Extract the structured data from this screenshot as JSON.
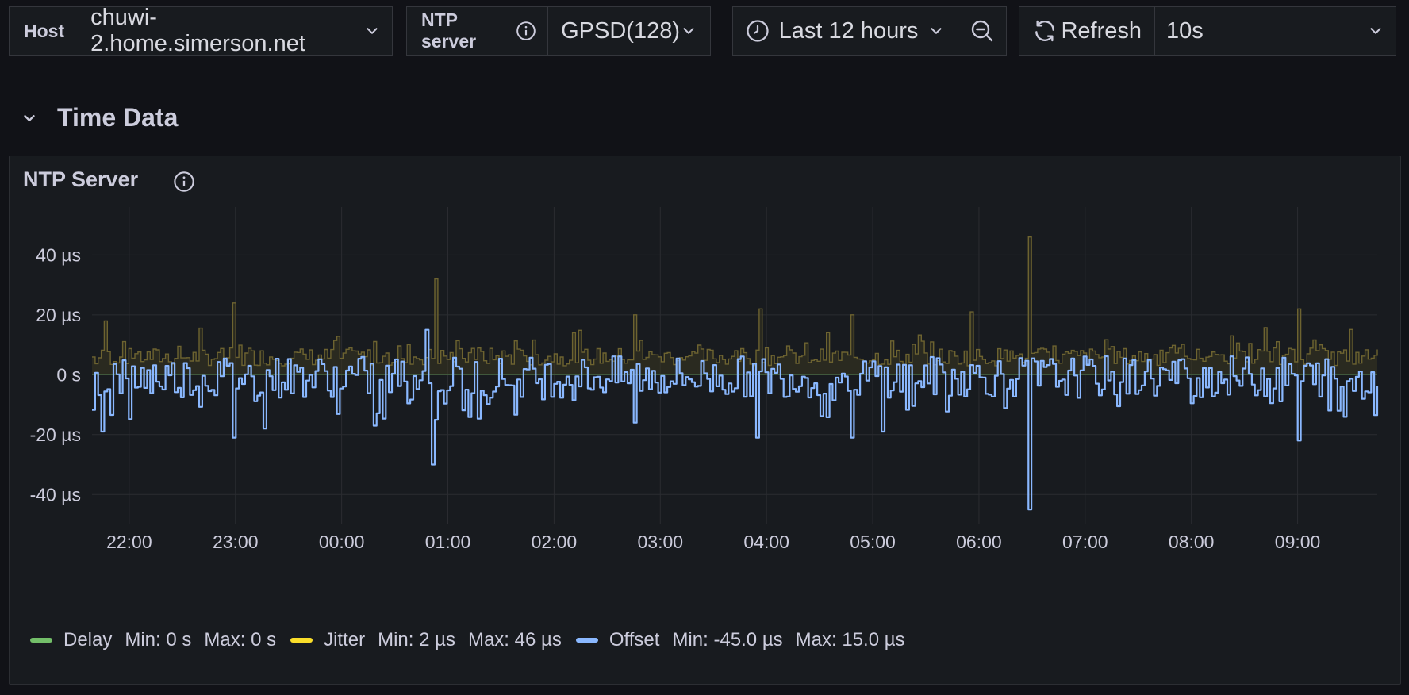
{
  "toolbar": {
    "host_label": "Host",
    "host_value": "chuwi-2.home.simerson.net",
    "ntp_label": "NTP server",
    "ntp_value": "GPSD(128)",
    "time_range": "Last 12 hours",
    "refresh_label": "Refresh",
    "refresh_interval": "10s"
  },
  "section": {
    "title": "Time Data"
  },
  "panel": {
    "title": "NTP Server",
    "legend": [
      {
        "name": "Delay",
        "color": "#73bf69",
        "min_label": "Min: 0 s",
        "max_label": "Max: 0 s"
      },
      {
        "name": "Jitter",
        "color": "#fade2a",
        "min_label": "Min: 2 µs",
        "max_label": "Max: 46 µs"
      },
      {
        "name": "Offset",
        "color": "#8ab8ff",
        "min_label": "Min: -45.0 µs",
        "max_label": "Max: 15.0 µs"
      }
    ]
  },
  "colors": {
    "background": "#111217",
    "panel": "#181b1f",
    "offset": "#8ab8ff",
    "jitter": "#fade2a",
    "delay": "#73bf69"
  },
  "chart_data": {
    "type": "line",
    "title": "NTP Server",
    "ylabel": "",
    "xlabel": "",
    "ylim": [
      -50,
      56
    ],
    "y_ticks": [
      {
        "value": 40,
        "label": "40 µs"
      },
      {
        "value": 20,
        "label": "20 µs"
      },
      {
        "value": 0,
        "label": "0 s"
      },
      {
        "value": -20,
        "label": "-20 µs"
      },
      {
        "value": -40,
        "label": "-40 µs"
      }
    ],
    "x_ticks": [
      "22:00",
      "23:00",
      "00:00",
      "01:00",
      "02:00",
      "03:00",
      "04:00",
      "05:00",
      "06:00",
      "07:00",
      "08:00",
      "09:00"
    ],
    "x_range_hours": [
      21.65,
      33.75
    ],
    "grid": true,
    "legend_position": "bottom",
    "series": [
      {
        "name": "Offset",
        "color": "#8ab8ff",
        "min": -45.0,
        "max": 15.0,
        "spikes": [
          {
            "t": 24.84,
            "v": -30
          },
          {
            "t": 24.8,
            "v": 15
          },
          {
            "t": 30.47,
            "v": -45
          },
          {
            "t": 22.97,
            "v": -21
          },
          {
            "t": 21.75,
            "v": -19
          },
          {
            "t": 23.25,
            "v": -18
          },
          {
            "t": 27.9,
            "v": -21
          },
          {
            "t": 29.09,
            "v": -19
          },
          {
            "t": 28.8,
            "v": -21
          },
          {
            "t": 32.99,
            "v": -22
          },
          {
            "t": 24.3,
            "v": -17
          },
          {
            "t": 26.76,
            "v": -16
          }
        ]
      },
      {
        "name": "Jitter",
        "color": "#fade2a",
        "min": 2,
        "max": 46,
        "spikes": [
          {
            "t": 30.47,
            "v": 46
          },
          {
            "t": 24.87,
            "v": 32
          },
          {
            "t": 22.97,
            "v": 24
          },
          {
            "t": 32.99,
            "v": 22
          },
          {
            "t": 27.93,
            "v": 22
          },
          {
            "t": 26.76,
            "v": 20
          },
          {
            "t": 28.8,
            "v": 20
          },
          {
            "t": 29.93,
            "v": 21
          },
          {
            "t": 21.77,
            "v": 18
          }
        ]
      },
      {
        "name": "Delay",
        "color": "#73bf69",
        "min": 0,
        "max": 0,
        "spikes": []
      }
    ]
  }
}
